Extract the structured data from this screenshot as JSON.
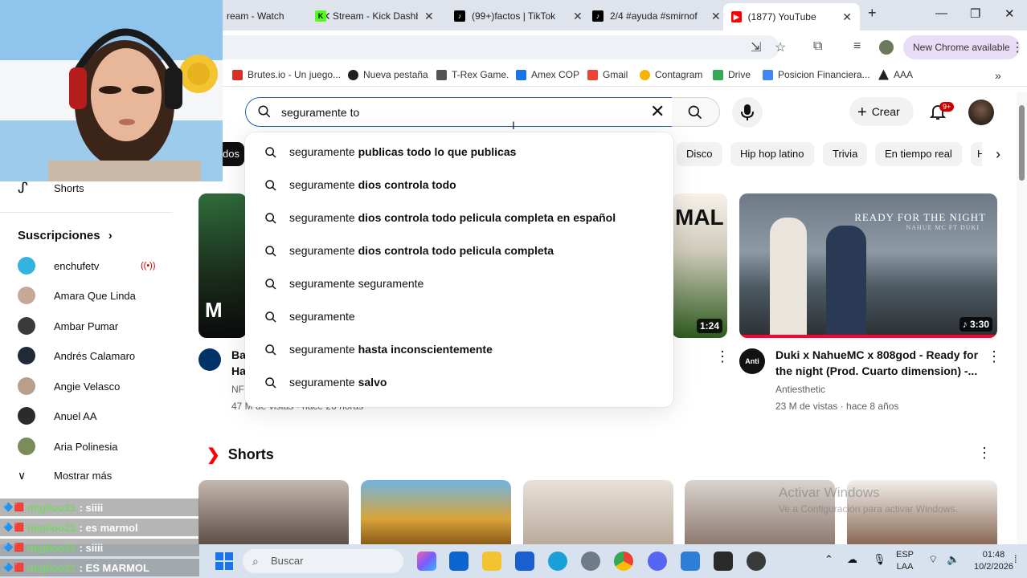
{
  "browser": {
    "tabs": [
      {
        "title": "ream - Watch",
        "fav_color": "#9146ff",
        "active": false
      },
      {
        "title": "Stream - Kick Dashbo",
        "fav_color": "#53fc18",
        "active": false
      },
      {
        "title": "(99+)factos | TikTok",
        "fav_color": "#000000",
        "active": false
      },
      {
        "title": "2/4 #ayuda #smirnof",
        "fav_color": "#000000",
        "active": false
      },
      {
        "title": "(1877) YouTube",
        "fav_color": "#ff0000",
        "active": true
      }
    ],
    "new_chrome_label": "New Chrome available",
    "bookmarks": [
      {
        "label": "Brutes.io - Un juego...",
        "color": "#d93025"
      },
      {
        "label": "Nueva pestaña",
        "color": "#202124"
      },
      {
        "label": "T-Rex Game.",
        "color": "#555555"
      },
      {
        "label": "Amex COP",
        "color": "#1a73e8"
      },
      {
        "label": "Gmail",
        "color": "#ea4335"
      },
      {
        "label": "Contagram",
        "color": "#f4b400"
      },
      {
        "label": "Drive",
        "color": "#34a853"
      },
      {
        "label": "Posicion Financiera...",
        "color": "#4285f4"
      },
      {
        "label": "AAA",
        "color": "#202124"
      }
    ]
  },
  "youtube": {
    "search": {
      "query": "seguramente to"
    },
    "create_label": "Crear",
    "notifications_badge": "9+",
    "chips": [
      "Disco",
      "Hip hop latino",
      "Trivia",
      "En tiempo real",
      "H"
    ],
    "active_chip": "dos",
    "suggestions": [
      {
        "prefix": "seguramente",
        "rest": "publicas todo lo que publicas"
      },
      {
        "prefix": "seguramente",
        "rest": "dios controla todo"
      },
      {
        "prefix": "seguramente",
        "rest": "dios controla todo pelicula completa en español"
      },
      {
        "prefix": "seguramente",
        "rest": "dios controla todo pelicula completa"
      },
      {
        "prefix": "seguramente seguramente",
        "rest": ""
      },
      {
        "prefix": "seguramente",
        "rest": ""
      },
      {
        "prefix": "seguramente",
        "rest": "hasta inconscientemente"
      },
      {
        "prefix": "seguramente",
        "rest": "salvo"
      }
    ],
    "sidebar": {
      "shorts_label": "Shorts",
      "subscriptions_title": "Suscripciones",
      "channels": [
        {
          "name": "enchufetv",
          "live": true,
          "color": "#34b3e0"
        },
        {
          "name": "Amara Que Linda",
          "live": false,
          "color": "#c6a996"
        },
        {
          "name": "Ambar Pumar",
          "live": false,
          "color": "#3a3a3a"
        },
        {
          "name": "Andrés Calamaro",
          "live": false,
          "color": "#1f2a36"
        },
        {
          "name": "Angie Velasco",
          "live": false,
          "color": "#b7a08b"
        },
        {
          "name": "Anuel AA",
          "live": false,
          "color": "#2b2b2b"
        },
        {
          "name": "Aria Polinesia",
          "live": false,
          "color": "#7b8c5c"
        }
      ],
      "show_more_label": "Mostrar más"
    },
    "videos": [
      {
        "title_line1": "Ba",
        "title_line2": "Ha",
        "channel": "NF",
        "meta": "47 M de vistas · hace 26 horas",
        "duration": ""
      },
      {
        "title_line1": "",
        "title_line2": "",
        "channel": "",
        "meta": "",
        "duration": "1:24"
      },
      {
        "title_line1": "Duki x NahueMC x 808god - Ready for",
        "title_line2": "the night (Prod. Cuarto dimension) -...",
        "channel": "Antiesthetic",
        "meta": "23 M de vistas · hace 8 años",
        "duration": "3:30",
        "thumb_text": "READY FOR THE NIGHT",
        "thumb_sub": "NAHUE MC FT DUKI"
      }
    ],
    "shorts_title": "Shorts",
    "thumb_left_text": "MAL"
  },
  "chat": [
    {
      "user": "miglioo21",
      "msg": ": siiii"
    },
    {
      "user": "miglioo21",
      "msg": ": es marmol"
    },
    {
      "user": "miglioo21",
      "msg": ": siiii"
    },
    {
      "user": "miglioo21",
      "msg": ": ES MARMOL"
    }
  ],
  "taskbar": {
    "search_placeholder": "Buscar",
    "lang_line1": "ESP",
    "lang_line2": "LAA",
    "time": "01:48",
    "date": "10/2/2026"
  },
  "watermark": {
    "title": "Activar Windows",
    "subtitle": "Ve a Configuración para activar Windows."
  }
}
